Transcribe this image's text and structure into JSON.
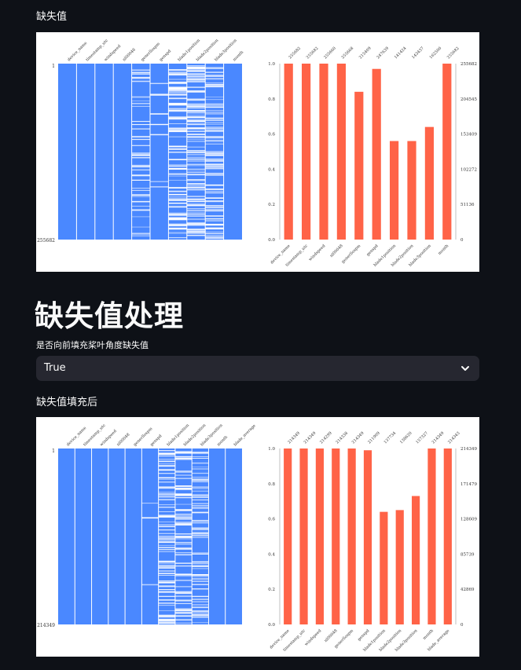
{
  "section1": {
    "label": "缺失值"
  },
  "section2": {
    "title": "缺失值处理",
    "select_label": "是否向前填充桨叶角度缺失值",
    "select_value": "True"
  },
  "section3": {
    "label": "缺失值填充后"
  },
  "panels": [
    {
      "matrix": {
        "columns": [
          "device_name",
          "timestamp_utc",
          "windspeed",
          "nl00048",
          "generllospm",
          "genspd",
          "blade1position",
          "blade2position",
          "blade3position",
          "month"
        ],
        "completeness": [
          1.0,
          1.0,
          1.0,
          1.0,
          0.84,
          0.97,
          0.56,
          0.56,
          0.64,
          1.0
        ],
        "row_top": "1",
        "row_bottom": "255682",
        "color": "#4a88ff"
      },
      "chart_data": {
        "type": "bar",
        "categories": [
          "device_name",
          "timestamp_utc",
          "windspeed",
          "nl00048",
          "generllospm",
          "genspd",
          "blade1position",
          "blade2position",
          "blade3position",
          "month"
        ],
        "values": [
          1.0,
          1.0,
          1.0,
          1.0,
          0.84,
          0.97,
          0.56,
          0.56,
          0.64,
          1.0
        ],
        "top_labels": [
          "255682",
          "255682",
          "255660",
          "255668",
          "215409",
          "247639",
          "141424",
          "143437",
          "162500",
          "255682"
        ],
        "yticks": [
          "0.0",
          "0.2",
          "0.4",
          "0.6",
          "0.8",
          "1.0"
        ],
        "right_ticks": [
          "0",
          "51136",
          "102272",
          "153409",
          "204545",
          "255682"
        ],
        "ylim": [
          0,
          1.0
        ],
        "color": "#ff6347"
      }
    },
    {
      "matrix": {
        "columns": [
          "device_name",
          "timestamp_utc",
          "windspeed",
          "nl00048",
          "generllospm",
          "genspd",
          "blade1position",
          "blade2position",
          "blade3position",
          "month",
          "blade_average"
        ],
        "completeness": [
          1.0,
          1.0,
          1.0,
          1.0,
          1.0,
          0.99,
          0.64,
          0.65,
          0.73,
          1.0,
          1.0
        ],
        "row_top": "1",
        "row_bottom": "214349",
        "color": "#4a88ff"
      },
      "chart_data": {
        "type": "bar",
        "categories": [
          "device_name",
          "timestamp_utc",
          "windspeed",
          "nl00048",
          "generllospm",
          "genspd",
          "blade1position",
          "blade2position",
          "blade3position",
          "month",
          "blade_average"
        ],
        "values": [
          1.0,
          1.0,
          1.0,
          1.0,
          1.0,
          0.99,
          0.64,
          0.65,
          0.73,
          1.0,
          1.0
        ],
        "top_labels": [
          "214349",
          "214349",
          "214299",
          "214338",
          "214349",
          "211909",
          "137734",
          "138620",
          "157327",
          "214349",
          "214343"
        ],
        "yticks": [
          "0.0",
          "0.2",
          "0.4",
          "0.6",
          "0.8",
          "1.0"
        ],
        "right_ticks": [
          "0",
          "42869",
          "85739",
          "128609",
          "171479",
          "214349"
        ],
        "ylim": [
          0,
          1.0
        ],
        "color": "#ff6347"
      }
    }
  ]
}
